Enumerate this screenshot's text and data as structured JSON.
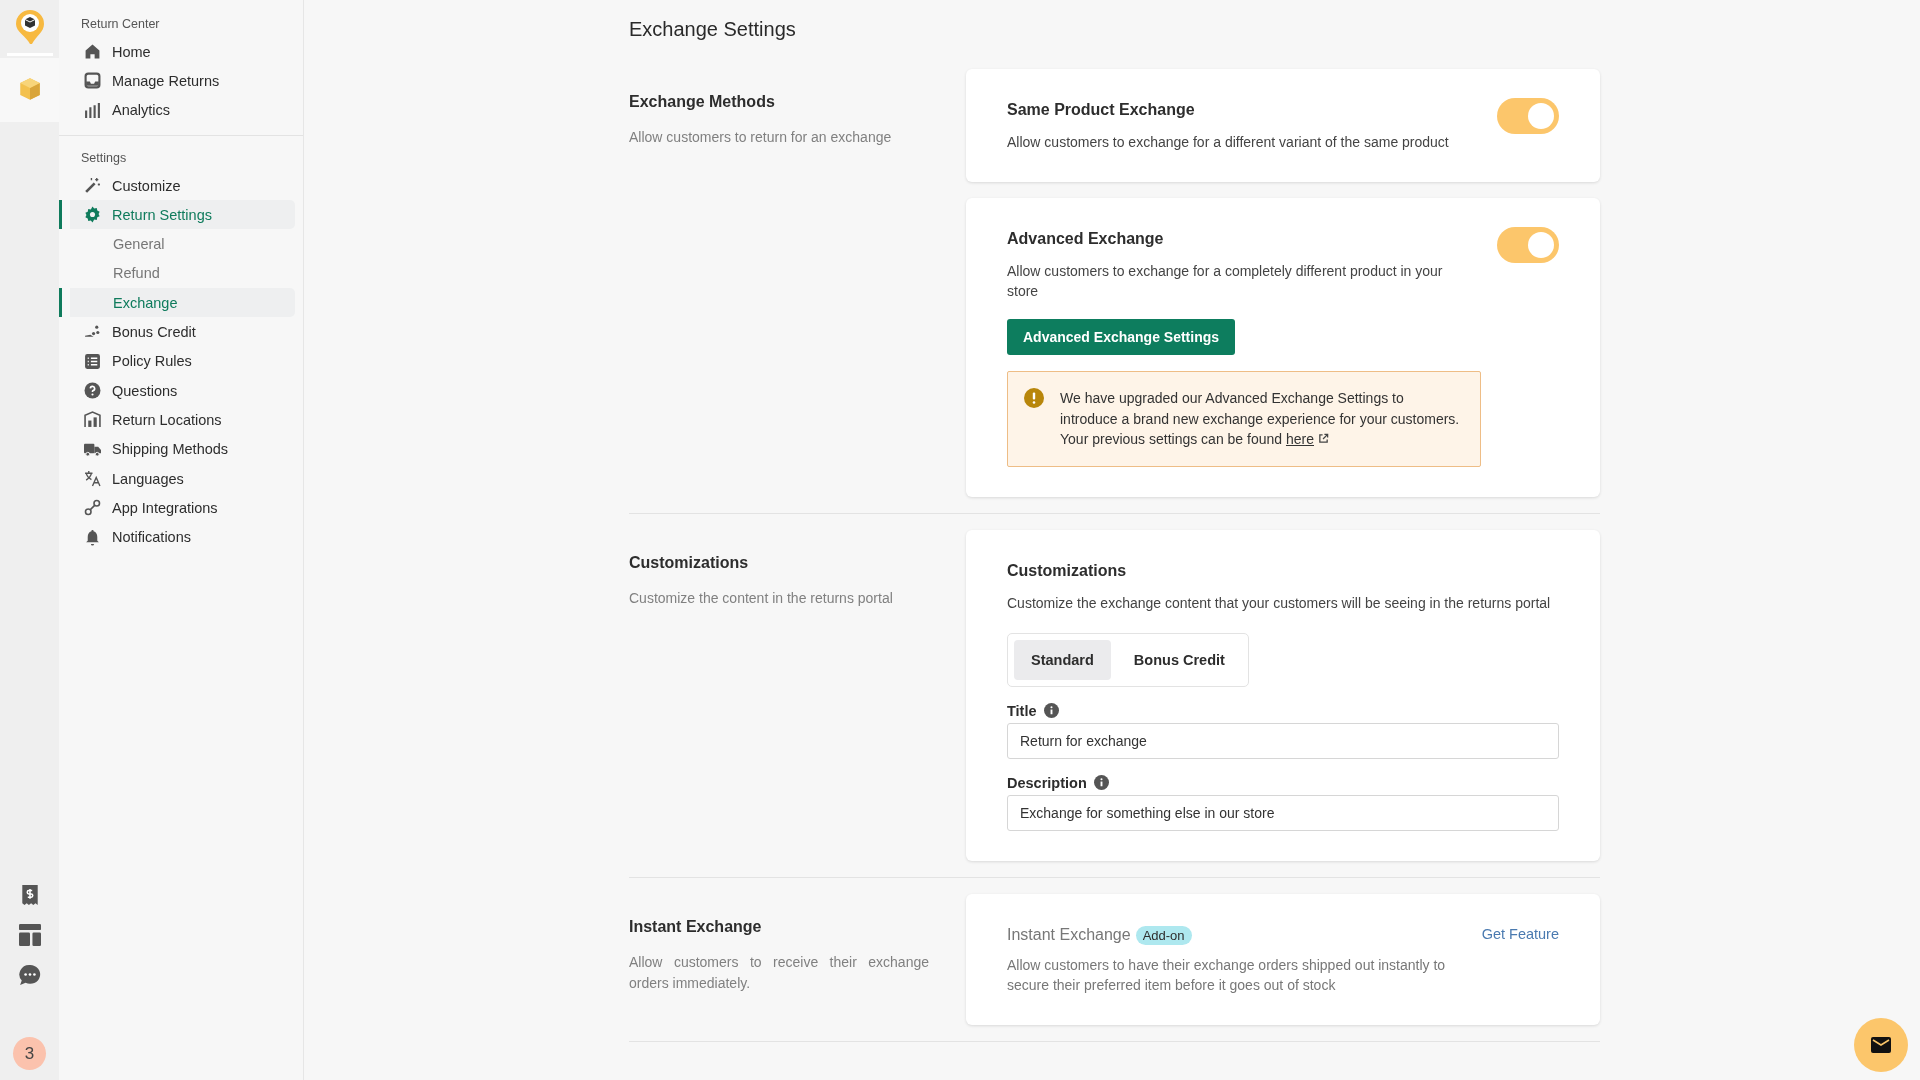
{
  "rail": {
    "apps": [
      {
        "kind": "logo",
        "selected": false
      },
      {
        "kind": "cube",
        "selected": true
      }
    ],
    "tools": [
      {
        "kind": "receipt"
      },
      {
        "kind": "layout"
      },
      {
        "kind": "chat"
      }
    ],
    "badge": "3"
  },
  "sidebar": {
    "sections": [
      {
        "title": "Return Center",
        "items": [
          {
            "kind": "home",
            "label": "Home",
            "selected": false
          },
          {
            "kind": "inbox",
            "label": "Manage Returns",
            "selected": false
          },
          {
            "kind": "chart",
            "label": "Analytics",
            "selected": false
          }
        ]
      },
      {
        "title": "Settings",
        "items": [
          {
            "kind": "wand",
            "label": "Customize",
            "selected": false
          },
          {
            "kind": "gear",
            "label": "Return Settings",
            "selected": true,
            "children": [
              {
                "label": "General",
                "selected": false
              },
              {
                "label": "Refund",
                "selected": false
              },
              {
                "label": "Exchange",
                "selected": true
              }
            ]
          },
          {
            "kind": "coins",
            "label": "Bonus Credit",
            "selected": false
          },
          {
            "kind": "list",
            "label": "Policy Rules",
            "selected": false
          },
          {
            "kind": "question",
            "label": "Questions",
            "selected": false
          },
          {
            "kind": "building",
            "label": "Return Locations",
            "selected": false
          },
          {
            "kind": "truck",
            "label": "Shipping Methods",
            "selected": false
          },
          {
            "kind": "translate",
            "label": "Languages",
            "selected": false
          },
          {
            "kind": "link",
            "label": "App Integrations",
            "selected": false
          },
          {
            "kind": "bell",
            "label": "Notifications",
            "selected": false
          }
        ]
      }
    ]
  },
  "main": {
    "title": "Exchange Settings",
    "sections": [
      {
        "title": "Exchange Methods",
        "description": "Allow customers to return for an exchange",
        "cards": [
          {
            "kind": "toggle",
            "title": "Same Product Exchange",
            "description": "Allow customers to exchange for a different variant of the same product",
            "on": true
          },
          {
            "kind": "toggle",
            "title": "Advanced Exchange",
            "description": "Allow customers to exchange for a completely different product in your store",
            "on": true,
            "button": "Advanced Exchange Settings",
            "notice": {
              "text": "We have upgraded our Advanced Exchange Settings to introduce a brand new exchange experience for your customers. Your previous settings can be found",
              "link": "here"
            }
          }
        ]
      },
      {
        "title": "Customizations",
        "description": "Customize the content in the returns portal",
        "cards": [
          {
            "kind": "customization",
            "title": "Customizations",
            "description": "Customize the exchange content that your customers will be seeing in the returns portal",
            "segments": [
              {
                "label": "Standard",
                "selected": true
              },
              {
                "label": "Bonus Credit",
                "selected": false
              }
            ],
            "fields": [
              {
                "label": "Title",
                "value": "Return for exchange"
              },
              {
                "label": "Description",
                "value": "Exchange for something else in our store"
              }
            ]
          }
        ]
      },
      {
        "title": "Instant Exchange",
        "description": "Allow customers to receive their exchange orders immediately.",
        "cards": [
          {
            "kind": "addon",
            "title": "Instant Exchange",
            "badge": "Add-on",
            "description": "Allow customers to have their exchange orders shipped out instantly to secure their preferred item before it goes out of stock",
            "link": "Get Feature",
            "disabled": true
          }
        ]
      }
    ]
  }
}
